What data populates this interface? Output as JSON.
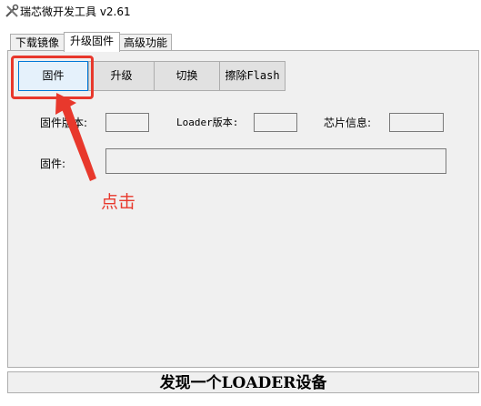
{
  "window": {
    "title": "瑞芯微开发工具 v2.61",
    "icon": "tools-icon"
  },
  "tabs": [
    {
      "label": "下载镜像",
      "active": false
    },
    {
      "label": "升级固件",
      "active": true
    },
    {
      "label": "高级功能",
      "active": false
    }
  ],
  "toolbar": {
    "firmware_label": "固件",
    "upgrade_label": "升级",
    "switch_label": "切换",
    "erase_label": "擦除Flash"
  },
  "info": {
    "firmware_version_label": "固件版本:",
    "firmware_version_value": "",
    "loader_version_label": "Loader版本:",
    "loader_version_value": "",
    "chip_info_label": "芯片信息:",
    "chip_info_value": "",
    "firmware_path_label": "固件:",
    "firmware_path_value": ""
  },
  "annotation": {
    "text": "点击",
    "color": "#e8382c"
  },
  "status": {
    "text": "发现一个LOADER设备"
  }
}
